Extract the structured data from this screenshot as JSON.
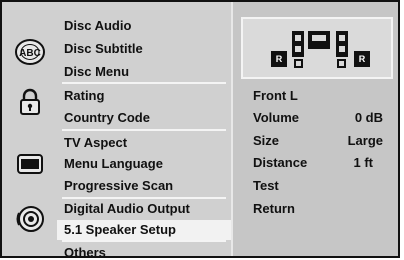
{
  "menu": {
    "groups": [
      {
        "icon": "disc-text-icon",
        "items": [
          "Disc Audio",
          "Disc Subtitle",
          "Disc Menu"
        ]
      },
      {
        "icon": "lock-icon",
        "items": [
          "Rating",
          "Country Code"
        ]
      },
      {
        "icon": "tv-icon",
        "items": [
          "TV Aspect",
          "Menu Language",
          "Progressive Scan"
        ]
      },
      {
        "icon": "speaker-icon",
        "items": [
          "Digital Audio Output",
          "5.1 Speaker Setup"
        ]
      },
      {
        "icon": "",
        "items": [
          "Others"
        ]
      }
    ],
    "selected_item": "5.1 Speaker Setup"
  },
  "speaker_panel": {
    "diagram_labels": {
      "rear_left": "R",
      "rear_right": "R"
    },
    "rows": [
      {
        "label": "Front L",
        "value": ""
      },
      {
        "label": "Volume",
        "value": "0 dB"
      },
      {
        "label": "Size",
        "value": "Large"
      },
      {
        "label": "Distance",
        "value": "1 ft"
      },
      {
        "label": "Test",
        "value": ""
      },
      {
        "label": "Return",
        "value": ""
      }
    ]
  }
}
